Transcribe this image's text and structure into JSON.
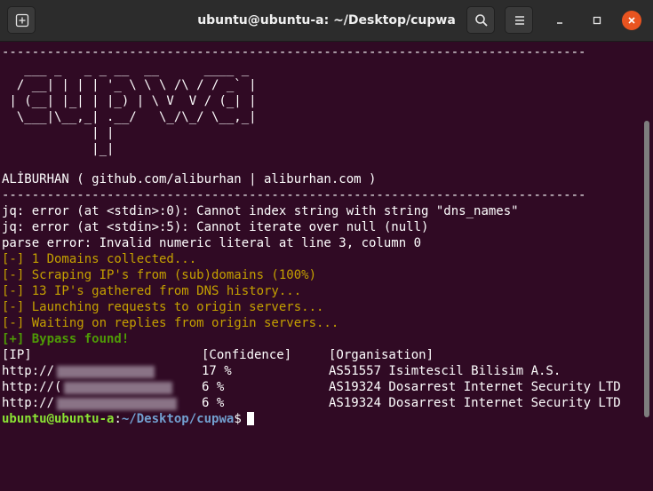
{
  "window": {
    "title": "ubuntu@ubuntu-a: ~/Desktop/cupwa",
    "close_color": "#e95420",
    "background": "#300a24"
  },
  "header_icons": [
    "new-tab-icon",
    "search-icon",
    "hamburger-menu-icon",
    "minimize-icon",
    "maximize-icon",
    "close-icon"
  ],
  "terminal": {
    "separator": "------------------------------------------------------------------------------",
    "banner": [
      "   ___ _   _ _ __  __      ____ _ ",
      "  / __| | | | '_ \\ \\ \\ /\\ / / _` |",
      " | (__| |_| | |_) | \\ V  V / (_| |",
      "  \\___|\\__,_| .__/   \\_/\\_/ \\__,_|",
      "            | |",
      "            |_|"
    ],
    "credit": "ALİBURHAN ( github.com/aliburhan | aliburhan.com )",
    "errors": [
      "jq: error (at <stdin>:0): Cannot index string with string \"dns_names\"",
      "jq: error (at <stdin>:5): Cannot iterate over null (null)",
      "parse error: Invalid numeric literal at line 3, column 0"
    ],
    "progress": [
      "[-] 1 Domains collected...",
      "[-] Scraping IP's from (sub)domains (100%)",
      "[-] 13 IP's gathered from DNS history...",
      "[-] Launching requests to origin servers...",
      "[-] Waiting on replies from origin servers..."
    ],
    "success": "[+] Bypass found!",
    "table": {
      "headers": [
        "[IP]",
        "[Confidence]",
        "[Organisation]"
      ],
      "rows": [
        {
          "ip": "http://",
          "confidence": "17 %",
          "organisation": "AS51557 Isimtescil Bilisim A.S."
        },
        {
          "ip": "http://(",
          "confidence": "6 %",
          "organisation": "AS19324 Dosarrest Internet Security LTD"
        },
        {
          "ip": "http://",
          "confidence": "6 %",
          "organisation": "AS19324 Dosarrest Internet Security LTD"
        }
      ]
    },
    "prompt": {
      "user": "ubuntu@ubuntu-a",
      "sep": ":",
      "path": "~/Desktop/cupwa",
      "symbol": "$"
    }
  }
}
